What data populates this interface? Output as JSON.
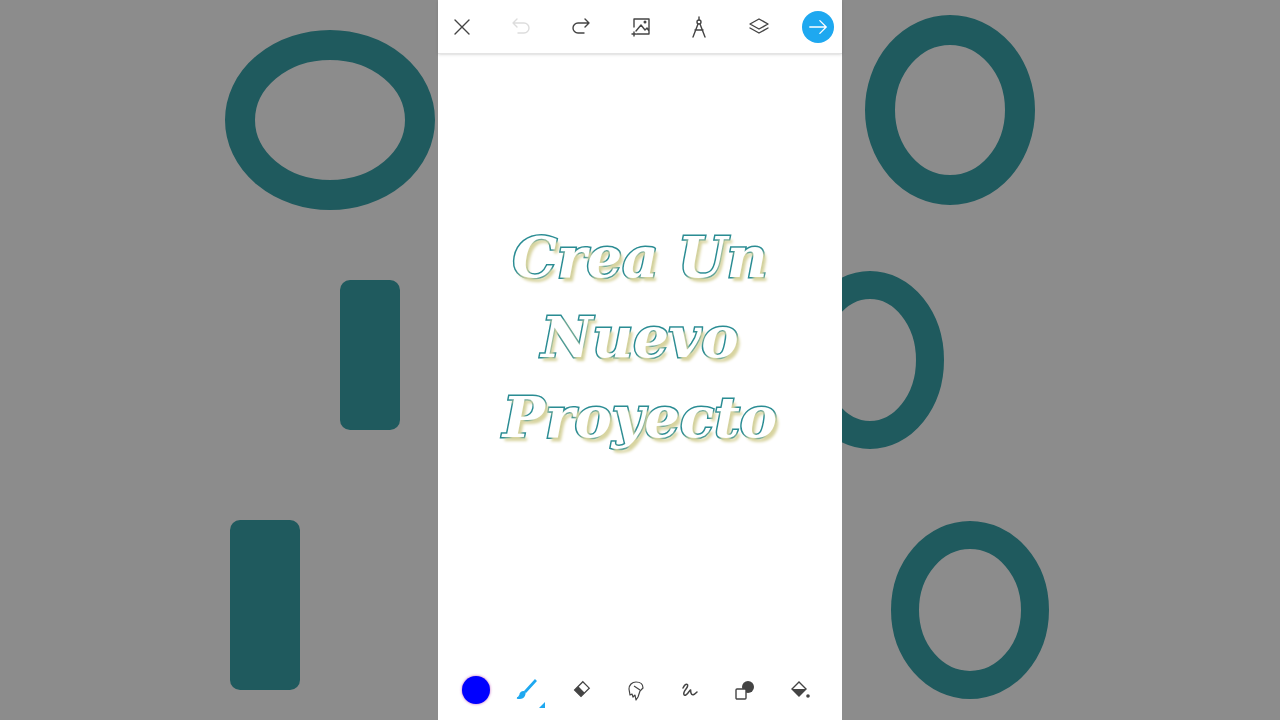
{
  "top_bar": {
    "tools": [
      {
        "kind": "close",
        "disabled": false
      },
      {
        "kind": "undo",
        "disabled": true
      },
      {
        "kind": "redo",
        "disabled": false
      },
      {
        "kind": "add-image",
        "disabled": false
      },
      {
        "kind": "compass",
        "disabled": false
      },
      {
        "kind": "layers",
        "disabled": false
      },
      {
        "kind": "next",
        "disabled": false
      }
    ]
  },
  "canvas": {
    "text_lines": [
      "Crea Un",
      "Nuevo",
      "Proyecto"
    ]
  },
  "bottom_bar": {
    "color": "#0000ff",
    "tools": [
      {
        "kind": "brush",
        "selected": true
      },
      {
        "kind": "eraser",
        "selected": false
      },
      {
        "kind": "smudge",
        "selected": false
      },
      {
        "kind": "stroke",
        "selected": false
      },
      {
        "kind": "shape",
        "selected": false
      },
      {
        "kind": "fill",
        "selected": false
      }
    ]
  }
}
